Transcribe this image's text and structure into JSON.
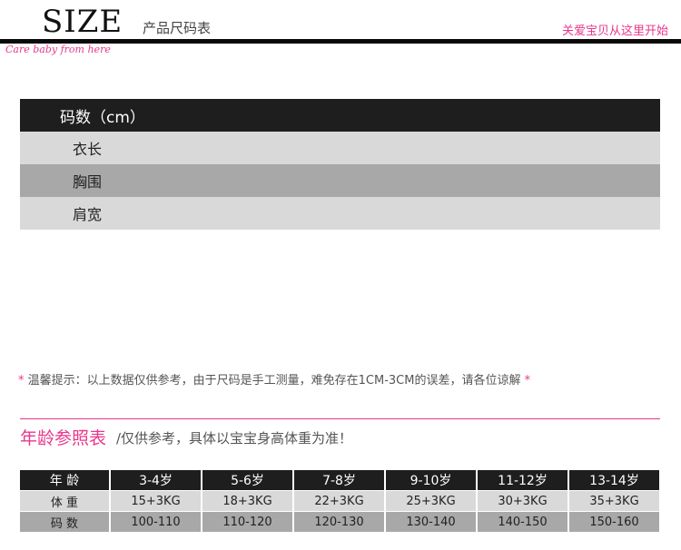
{
  "header": {
    "title": "SIZE",
    "subtitle": "产品尺码表",
    "slogan": "关爱宝贝从这里开始",
    "tagline": "Care baby from here"
  },
  "size_table": {
    "header": "码数（cm）",
    "rows": [
      "衣长",
      "胸围",
      "肩宽"
    ]
  },
  "note": {
    "star_left": "*",
    "text": "温馨提示：以上数据仅供参考，由于尺码是手工测量，难免存在1CM-3CM的误差，请各位谅解",
    "star_right": "*"
  },
  "age_reference": {
    "title": "年龄参照表",
    "description": "/仅供参考，具体以宝宝身高体重为准！",
    "header_label": "年 龄",
    "weight_label": "体 重",
    "size_label": "码 数",
    "ages": [
      "3-4岁",
      "5-6岁",
      "7-8岁",
      "9-10岁",
      "11-12岁",
      "13-14岁"
    ],
    "weights": [
      "15+3KG",
      "18+3KG",
      "22+3KG",
      "25+3KG",
      "30+3KG",
      "35+3KG"
    ],
    "sizes": [
      "100-110",
      "110-120",
      "120-130",
      "130-140",
      "140-150",
      "150-160"
    ]
  }
}
